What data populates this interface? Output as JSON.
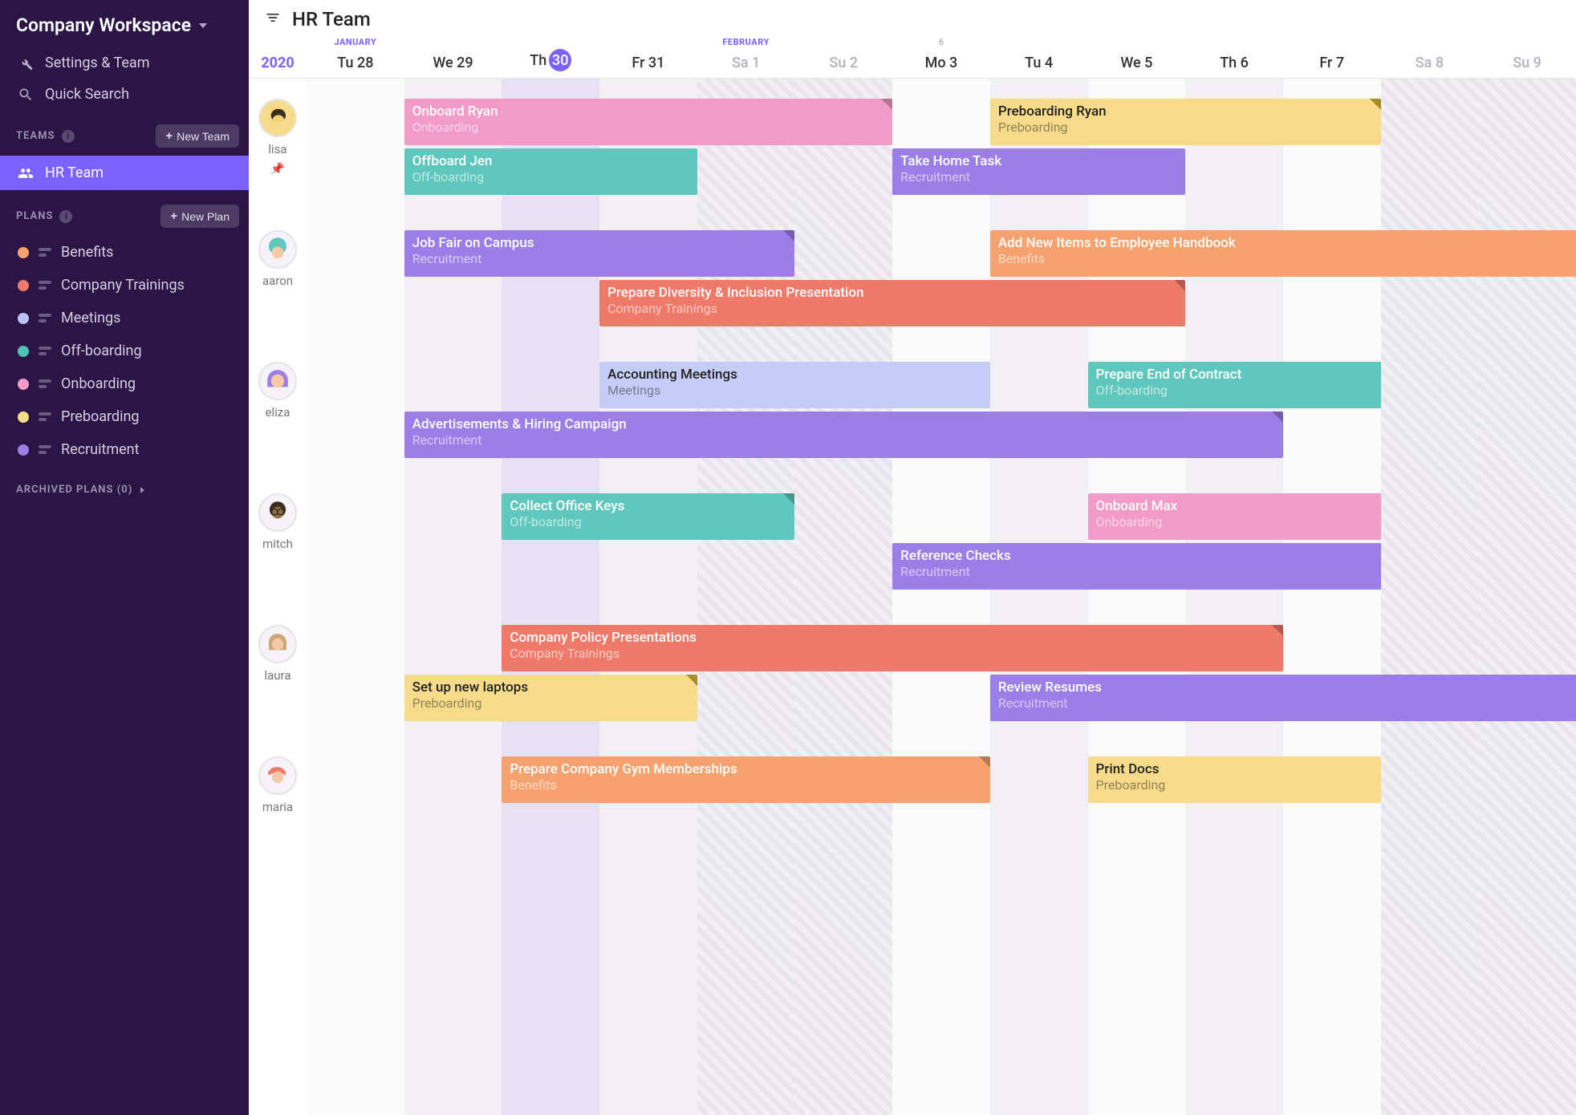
{
  "sidebar": {
    "workspace": "Company Workspace",
    "settings": "Settings & Team",
    "quickSearch": "Quick Search",
    "teamsLabel": "TEAMS",
    "newTeam": "New Team",
    "plansLabel": "PLANS",
    "newPlan": "New Plan",
    "archivedLabel": "ARCHIVED PLANS (0)",
    "teams": [
      {
        "name": "HR Team",
        "active": true
      }
    ],
    "plans": [
      {
        "name": "Benefits",
        "color": "#f5a26f"
      },
      {
        "name": "Company Trainings",
        "color": "#f07a6a"
      },
      {
        "name": "Meetings",
        "color": "#b9c2f2"
      },
      {
        "name": "Off-boarding",
        "color": "#4fc3b8"
      },
      {
        "name": "Onboarding",
        "color": "#f29ac8"
      },
      {
        "name": "Preboarding",
        "color": "#f5db8a"
      },
      {
        "name": "Recruitment",
        "color": "#9b7ee6"
      }
    ]
  },
  "header": {
    "title": "HR Team",
    "year": "2020",
    "days": [
      {
        "dow": "Tu",
        "num": "28",
        "month": "JANUARY",
        "weekend": false,
        "today": false
      },
      {
        "dow": "We",
        "num": "29",
        "weekend": false,
        "today": false
      },
      {
        "dow": "Th",
        "num": "30",
        "weekend": false,
        "today": true
      },
      {
        "dow": "Fr",
        "num": "31",
        "weekend": false,
        "today": false
      },
      {
        "dow": "Sa",
        "num": "1",
        "month": "FEBRUARY",
        "weekend": true,
        "today": false
      },
      {
        "dow": "Su",
        "num": "2",
        "weekend": true,
        "today": false
      },
      {
        "dow": "Mo",
        "num": "3",
        "week": "6",
        "weekend": false,
        "today": false
      },
      {
        "dow": "Tu",
        "num": "4",
        "weekend": false,
        "today": false
      },
      {
        "dow": "We",
        "num": "5",
        "weekend": false,
        "today": false
      },
      {
        "dow": "Th",
        "num": "6",
        "weekend": false,
        "today": false
      },
      {
        "dow": "Fr",
        "num": "7",
        "weekend": false,
        "today": false
      },
      {
        "dow": "Sa",
        "num": "8",
        "weekend": true,
        "today": false
      },
      {
        "dow": "Su",
        "num": "9",
        "weekend": true,
        "today": false
      }
    ]
  },
  "colors": {
    "Benefits": "#f5a26f",
    "Company Trainings": "#f07a6a",
    "Meetings": "#c3cdf5",
    "Off-boarding": "#5fc7bd",
    "Onboarding": "#f29ac8",
    "Preboarding": "#f5db8a",
    "Recruitment": "#9b7ee6"
  },
  "people": [
    {
      "name": "lisa",
      "pinned": true,
      "rows": [
        [
          {
            "title": "Onboard Ryan",
            "cat": "Onboarding",
            "start": 1,
            "end": 6,
            "text": "light",
            "corner": true
          },
          {
            "title": "Preboarding Ryan",
            "cat": "Preboarding",
            "start": 7,
            "end": 11,
            "text": "dark",
            "cornerYellow": true
          }
        ],
        [
          {
            "title": "Offboard Jen",
            "cat": "Off-boarding",
            "start": 1,
            "end": 4,
            "text": "light"
          },
          {
            "title": "Take Home Task",
            "cat": "Recruitment",
            "start": 6,
            "end": 9,
            "text": "light"
          }
        ]
      ]
    },
    {
      "name": "aaron",
      "rows": [
        [
          {
            "title": "Job Fair on Campus",
            "cat": "Recruitment",
            "start": 1,
            "end": 5,
            "text": "light",
            "corner": true
          },
          {
            "title": "Add New Items to Employee Handbook",
            "cat": "Benefits",
            "start": 7,
            "end": 13,
            "text": "light",
            "overflow": true
          }
        ],
        [
          {
            "title": "Prepare Diversity & Inclusion Presentation",
            "cat": "Company Trainings",
            "start": 3,
            "end": 9,
            "text": "light",
            "corner": true
          }
        ]
      ]
    },
    {
      "name": "eliza",
      "rows": [
        [
          {
            "title": "Accounting Meetings",
            "cat": "Meetings",
            "start": 3,
            "end": 7,
            "text": "dark"
          },
          {
            "title": "Prepare End of Contract",
            "cat": "Off-boarding",
            "start": 8,
            "end": 11,
            "text": "light",
            "overflow": true
          }
        ],
        [
          {
            "title": "Advertisements & Hiring Campaign",
            "cat": "Recruitment",
            "start": 1,
            "end": 10,
            "text": "light",
            "corner": true
          }
        ]
      ]
    },
    {
      "name": "mitch",
      "rows": [
        [
          {
            "title": "Collect Office Keys",
            "cat": "Off-boarding",
            "start": 2,
            "end": 5,
            "text": "light",
            "corner": true
          },
          {
            "title": "Onboard Max",
            "cat": "Onboarding",
            "start": 8,
            "end": 11,
            "text": "light",
            "overflow": true
          }
        ],
        [
          {
            "title": "Reference Checks",
            "cat": "Recruitment",
            "start": 6,
            "end": 11,
            "text": "light",
            "overflow": true
          }
        ]
      ]
    },
    {
      "name": "laura",
      "rows": [
        [
          {
            "title": "Company Policy Presentations",
            "cat": "Company Trainings",
            "start": 2,
            "end": 10,
            "text": "light",
            "corner": true
          }
        ],
        [
          {
            "title": "Set up new laptops",
            "cat": "Preboarding",
            "start": 1,
            "end": 4,
            "text": "dark",
            "cornerYellow": true
          },
          {
            "title": "Review Resumes",
            "cat": "Recruitment",
            "start": 7,
            "end": 13,
            "text": "light",
            "overflow": true
          }
        ]
      ]
    },
    {
      "name": "maria",
      "rows": [
        [
          {
            "title": "Prepare Company Gym Memberships",
            "cat": "Benefits",
            "start": 2,
            "end": 7,
            "text": "light",
            "corner": true
          },
          {
            "title": "Print Docs",
            "cat": "Preboarding",
            "start": 8,
            "end": 11,
            "text": "dark"
          }
        ]
      ]
    }
  ]
}
